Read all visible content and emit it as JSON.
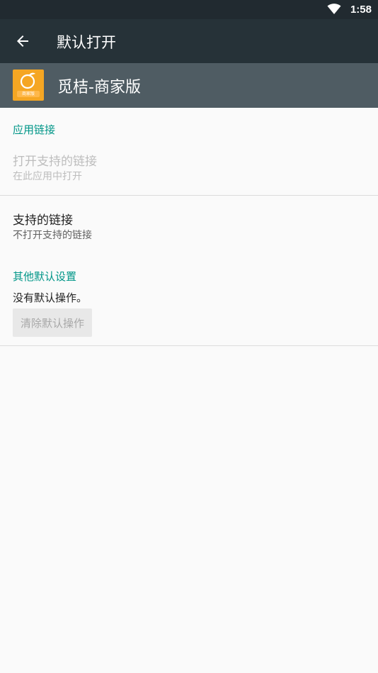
{
  "status_bar": {
    "time": "1:58",
    "wifi_icon": "wifi-icon"
  },
  "toolbar": {
    "title": "默认打开",
    "back_icon": "arrow-back-icon"
  },
  "app": {
    "name": "觅桔-商家版",
    "icon_badge": "商家版",
    "icon_color": "#f5a623"
  },
  "sections": {
    "app_links": {
      "header": "应用链接",
      "open_supported_links": {
        "title": "打开支持的链接",
        "subtitle": "在此应用中打开"
      },
      "supported_links": {
        "title": "支持的链接",
        "subtitle": "不打开支持的链接"
      }
    },
    "other_defaults": {
      "header": "其他默认设置",
      "no_defaults_text": "没有默认操作。",
      "clear_button": "清除默认操作"
    }
  },
  "colors": {
    "accent": "#009688",
    "toolbar": "#263238",
    "status_bar": "#212a30",
    "app_header": "#4f5c63"
  }
}
